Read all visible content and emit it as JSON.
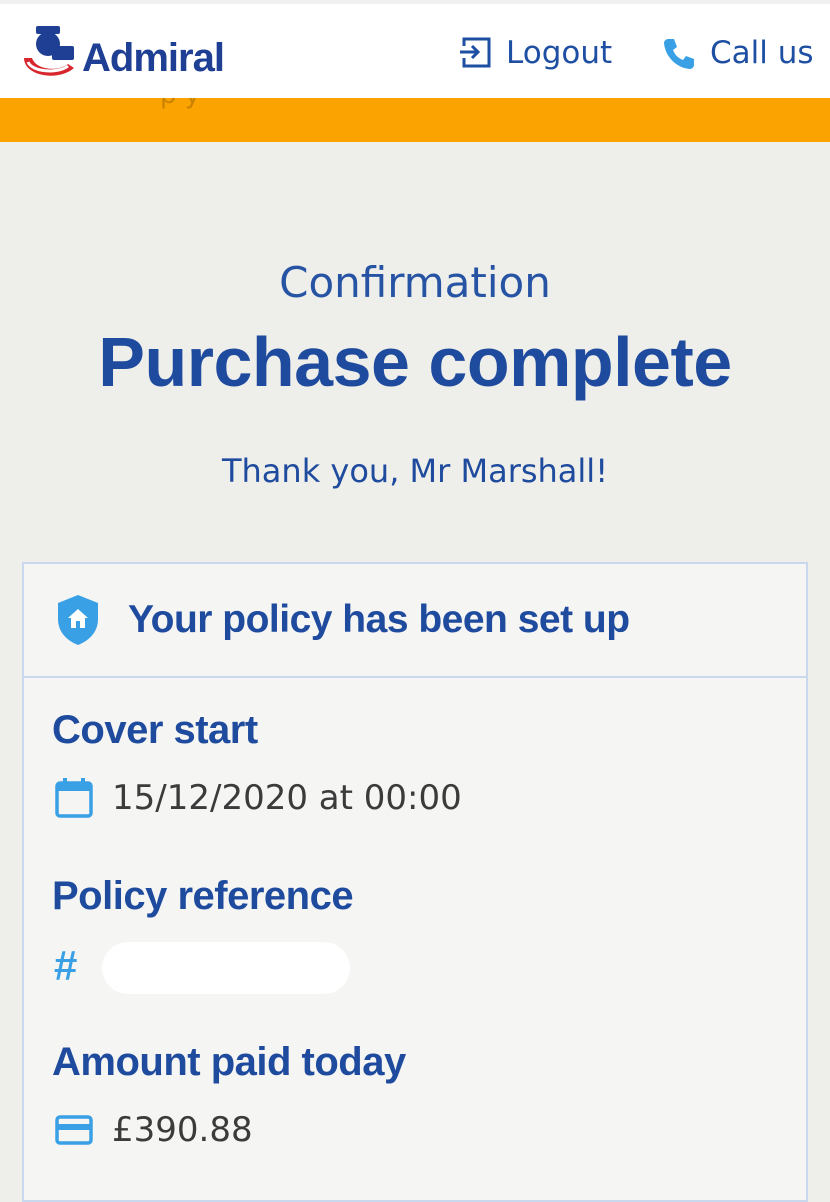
{
  "header": {
    "brand": "Admiral",
    "logout_label": "Logout",
    "call_label": "Call us"
  },
  "colors": {
    "brand_blue": "#1f4b9e",
    "icon_blue": "#3aa0e6",
    "banner_orange": "#fba300",
    "background": "#eeeeea"
  },
  "page": {
    "kicker": "Confirmation",
    "headline": "Purchase complete",
    "thanks": "Thank you, Mr Marshall!"
  },
  "card": {
    "title": "Your policy has been set up",
    "cover_start_label": "Cover start",
    "cover_start_value": "15/12/2020 at 00:00",
    "policy_ref_label": "Policy reference",
    "amount_label": "Amount paid today",
    "amount_value": "£390.88"
  },
  "icons": [
    "logout-icon",
    "phone-icon",
    "shield-home-icon",
    "calendar-icon",
    "hash-icon",
    "credit-card-icon"
  ]
}
